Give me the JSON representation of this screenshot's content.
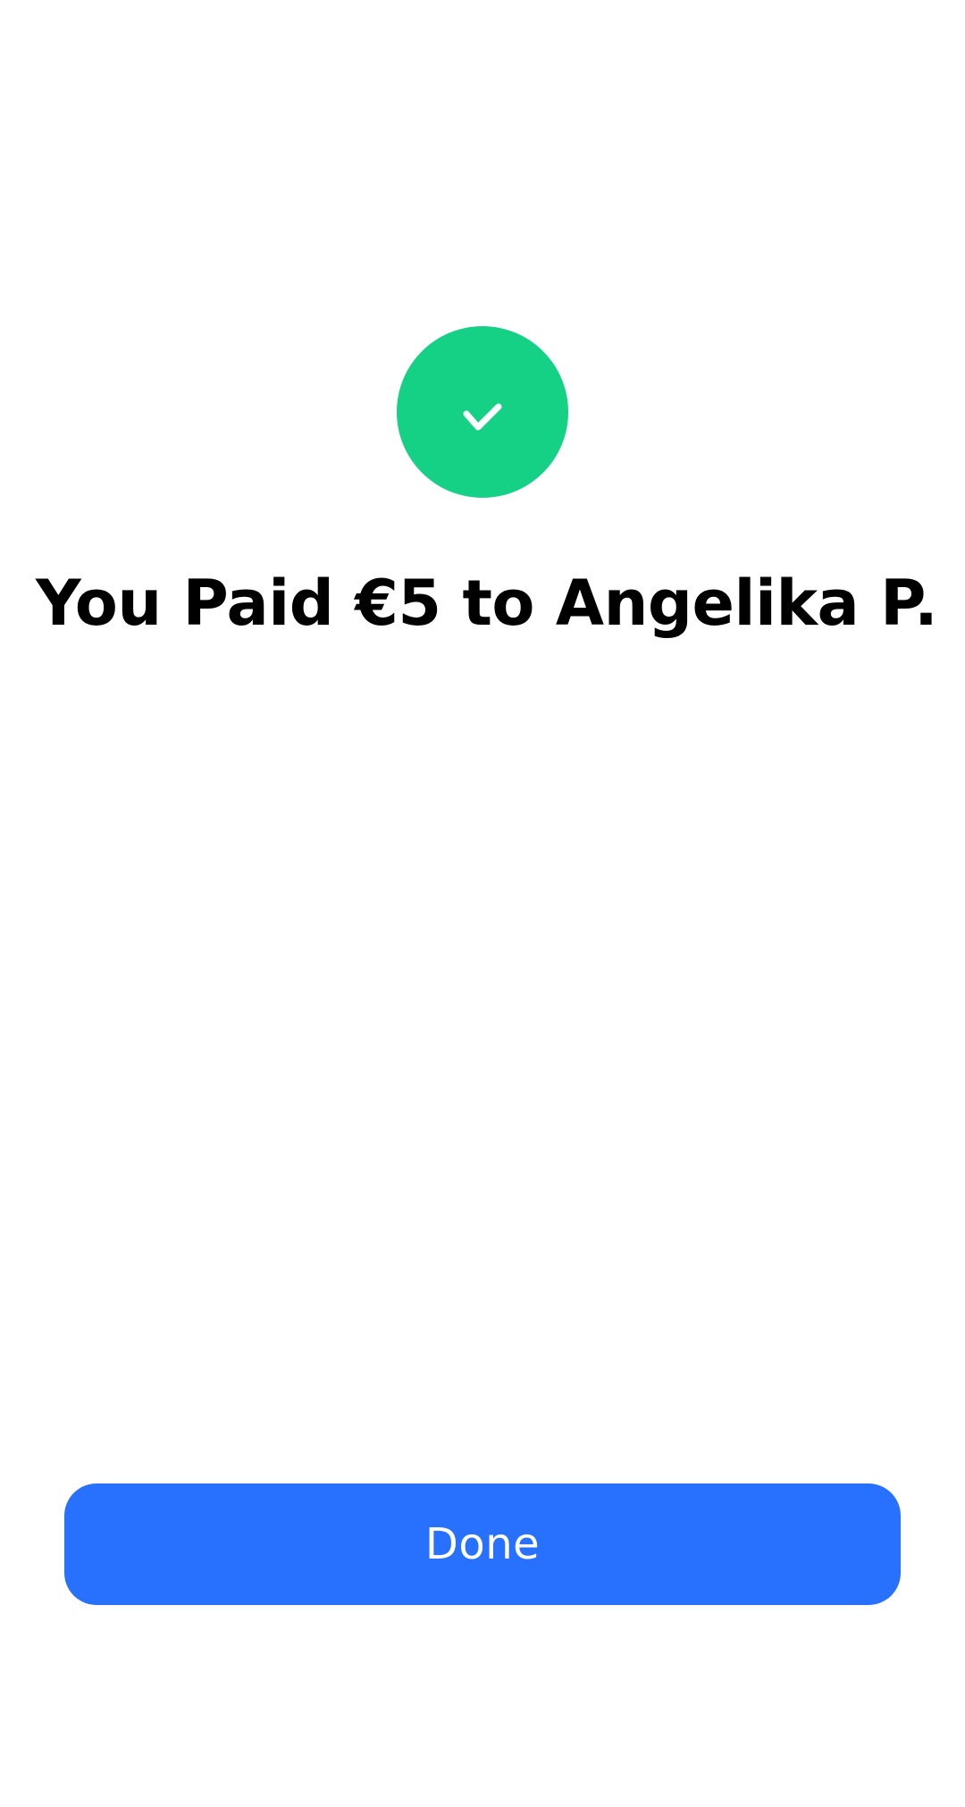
{
  "confirmation": {
    "icon": "checkmark-icon",
    "title": "You Paid €5 to Angelika P."
  },
  "actions": {
    "done_label": "Done"
  },
  "colors": {
    "success": "#14D186",
    "primary": "#2870FE",
    "text": "#000000",
    "background": "#FFFFFF"
  }
}
